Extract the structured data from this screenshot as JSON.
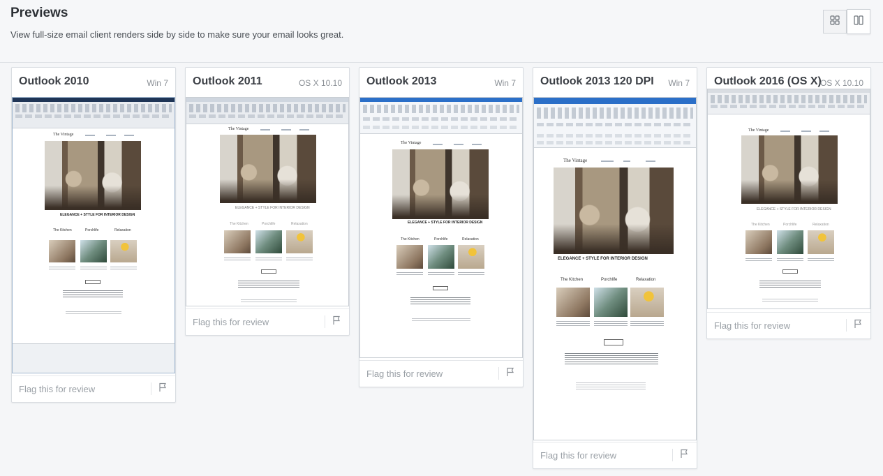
{
  "header": {
    "title": "Previews",
    "subtitle": "View full-size email client renders side by side to make sure your email looks great.",
    "view_toggle": {
      "grid": "grid-icon",
      "columns": "columns-icon",
      "active": "columns"
    }
  },
  "cards": [
    {
      "client": "Outlook 2010",
      "os": "Win 7",
      "flag_label": "Flag this for review"
    },
    {
      "client": "Outlook 2011",
      "os": "OS X 10.10",
      "flag_label": "Flag this for review"
    },
    {
      "client": "Outlook 2013",
      "os": "Win 7",
      "flag_label": "Flag this for review"
    },
    {
      "client": "Outlook 2013 120 DPI",
      "os": "Win 7",
      "flag_label": "Flag this for review"
    },
    {
      "client": "Outlook 2016 (OS X)",
      "os": "OS X 10.10",
      "flag_label": "Flag this for review"
    }
  ],
  "email": {
    "brand": "The Vintage",
    "tagline": "ELEGANCE + STYLE FOR INTERIOR DESIGN",
    "categories": [
      "The Kitchen",
      "Porchlife",
      "Relaxation"
    ]
  },
  "colors": {
    "accent_blue": "#2b6fc8",
    "muted_text": "#9aa0a6"
  }
}
